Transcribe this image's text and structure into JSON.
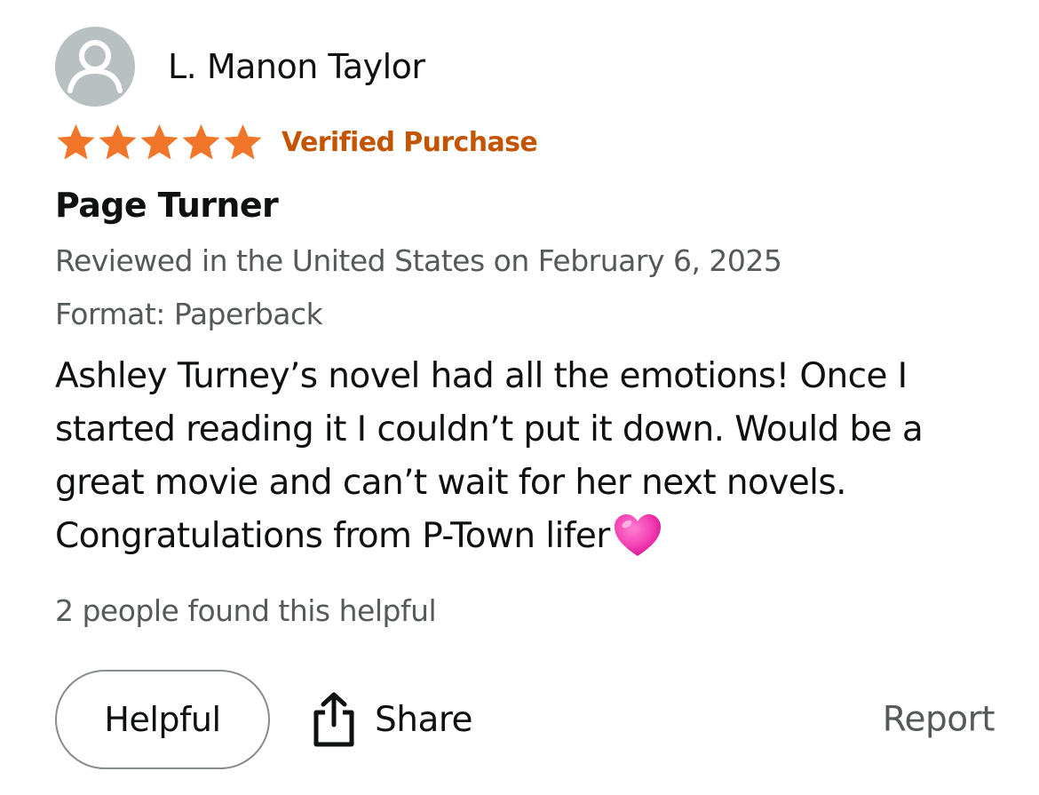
{
  "reviewer": {
    "name": "L. Manon Taylor",
    "avatar_icon": "default-user-avatar"
  },
  "rating": {
    "stars": 5,
    "max": 5,
    "star_color": "#f2762a",
    "verified_label": "Verified Purchase",
    "verified_color": "#c45500"
  },
  "review": {
    "title": "Page Turner",
    "reviewed_in": "Reviewed in the United States on February 6, 2025",
    "format": "Format: Paperback",
    "body": "Ashley Turney’s novel had all the emotions! Once I started reading it I couldn’t put it down. Would be a great movie and can’t wait for her next novels. Congratulations from P-Town lifer",
    "body_emoji": "pink-heart-emoji"
  },
  "helpful_count_text": "2 people found this helpful",
  "actions": {
    "helpful_label": "Helpful",
    "share_label": "Share",
    "share_icon": "share-icon",
    "report_label": "Report"
  }
}
